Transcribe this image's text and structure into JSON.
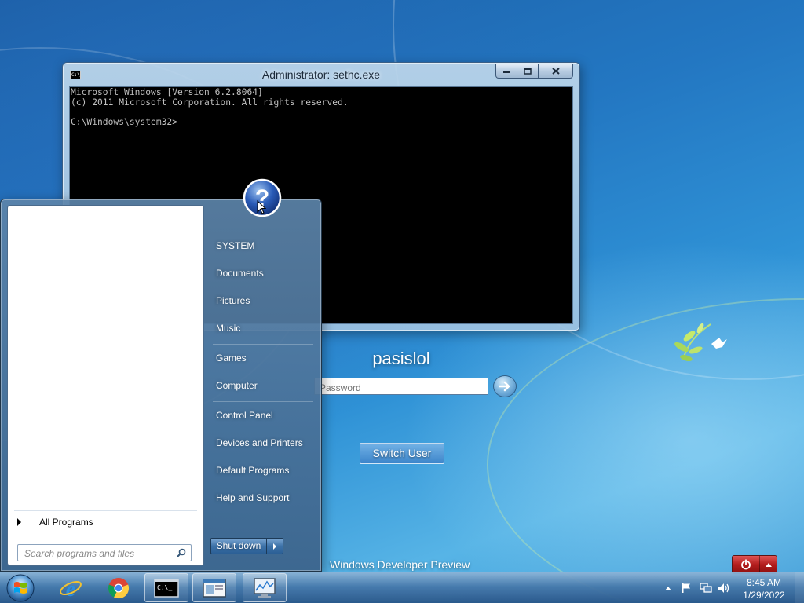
{
  "console": {
    "title": "Administrator: sethc.exe",
    "icon": "cmd-icon",
    "lines": [
      "Microsoft Windows [Version 6.2.8064]",
      "(c) 2011 Microsoft Corporation. All rights reserved.",
      "",
      "C:\\Windows\\system32>"
    ],
    "controls": {
      "minimize": "minimize-icon",
      "maximize": "maximize-icon",
      "close": "close-icon"
    }
  },
  "logon": {
    "username": "pasislol",
    "password_placeholder": "Password",
    "submit_icon": "arrow-right-icon",
    "switch_user_label": "Switch User",
    "branding": "Windows Developer Preview",
    "power_icon": "power-icon"
  },
  "start_menu": {
    "all_programs_label": "All Programs",
    "search_placeholder": "Search programs and files",
    "right_items": [
      "SYSTEM",
      "Documents",
      "Pictures",
      "Music",
      "Games",
      "Computer",
      "Control Panel",
      "Devices and Printers",
      "Default Programs",
      "Help and Support"
    ],
    "shutdown_label": "Shut down",
    "user_picture_icon": "help-question-icon"
  },
  "taskbar": {
    "pinned": [
      {
        "name": "start-orb",
        "icon": "windows-logo-icon"
      },
      {
        "name": "internet-explorer",
        "icon": "internet-explorer-icon"
      },
      {
        "name": "chrome",
        "icon": "chrome-icon"
      },
      {
        "name": "command-prompt",
        "icon": "cmd-icon",
        "active": true
      },
      {
        "name": "window-app",
        "icon": "window-icon"
      },
      {
        "name": "resource-monitor",
        "icon": "monitor-chart-icon"
      }
    ],
    "tray_icons": [
      "show-hidden-icons-icon",
      "action-center-flag-icon",
      "network-icon",
      "volume-icon"
    ],
    "time": "8:45 AM",
    "date": "1/29/2022"
  },
  "colors": {
    "desktop_blue": "#2377c2",
    "console_bg": "#000000",
    "console_text": "#c0c0c0",
    "power_red": "#b31d1d"
  }
}
